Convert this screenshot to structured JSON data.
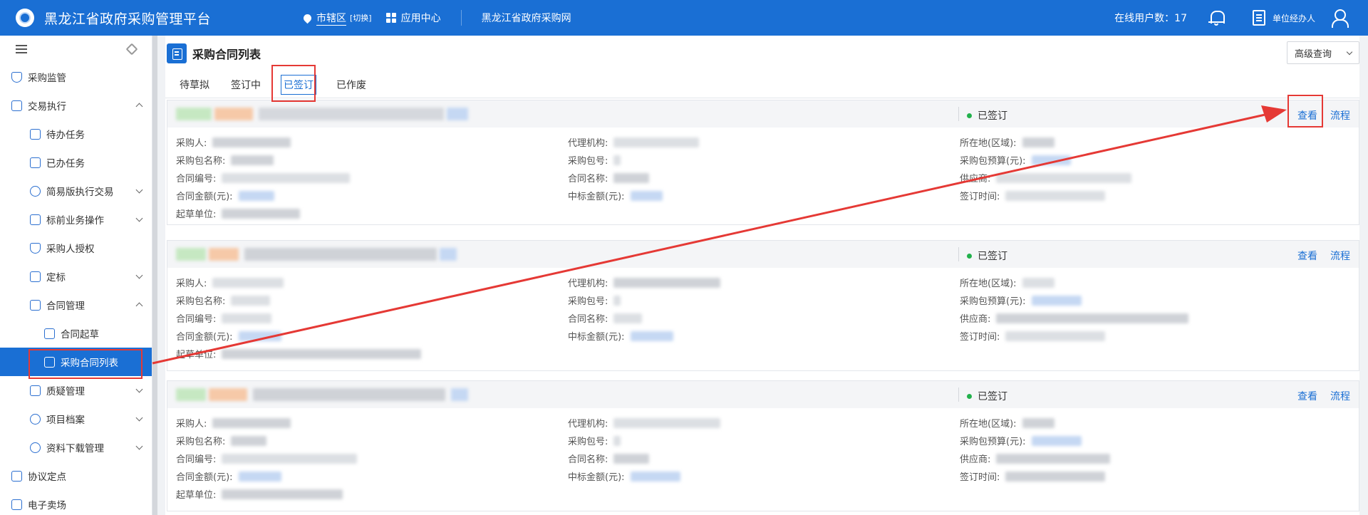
{
  "app": {
    "title": "黑龙江省政府采购管理平台",
    "region": "市辖区",
    "region_switch": "[切换]",
    "app_center": "应用中心",
    "portal": "黑龙江省政府采购网",
    "online_label": "在线用户数：17",
    "role": "单位经办人"
  },
  "sidebar": {
    "items": [
      {
        "label": "采购监管",
        "icon": "shield-icon",
        "level": 0
      },
      {
        "label": "交易执行",
        "icon": "receipt-icon",
        "level": 0,
        "expanded": true
      },
      {
        "label": "待办任务",
        "icon": "task-icon",
        "level": 1
      },
      {
        "label": "已办任务",
        "icon": "task-done-icon",
        "level": 1
      },
      {
        "label": "简易版执行交易",
        "icon": "simple-trade-icon",
        "level": 1,
        "collapsed": true
      },
      {
        "label": "标前业务操作",
        "icon": "cart-icon",
        "level": 1,
        "collapsed": true
      },
      {
        "label": "采购人授权",
        "icon": "shield-check-icon",
        "level": 1
      },
      {
        "label": "定标",
        "icon": "award-icon",
        "level": 1,
        "collapsed": true
      },
      {
        "label": "合同管理",
        "icon": "contract-icon",
        "level": 1,
        "expanded": true
      },
      {
        "label": "合同起草",
        "icon": "draft-icon",
        "level": 2
      },
      {
        "label": "采购合同列表",
        "icon": "list-icon",
        "level": 2,
        "active": true
      },
      {
        "label": "质疑管理",
        "icon": "cart-icon",
        "level": 1,
        "collapsed": true
      },
      {
        "label": "项目档案",
        "icon": "user-circle-icon",
        "level": 1,
        "collapsed": true
      },
      {
        "label": "资料下载管理",
        "icon": "link-icon",
        "level": 1,
        "collapsed": true
      },
      {
        "label": "协议定点",
        "icon": "agreement-icon",
        "level": 0
      },
      {
        "label": "电子卖场",
        "icon": "store-icon",
        "level": 0
      }
    ]
  },
  "page": {
    "title": "采购合同列表",
    "advanced_query": "高级查询"
  },
  "tabs": [
    {
      "label": "待草拟"
    },
    {
      "label": "签订中"
    },
    {
      "label": "已签订",
      "active": true
    },
    {
      "label": "已作废"
    }
  ],
  "labels": {
    "buyer": "采购人:",
    "package_name": "采购包名称:",
    "contract_no": "合同编号:",
    "contract_amount": "合同金额(元):",
    "drafting_unit": "起草单位:",
    "agency": "代理机构:",
    "package_no": "采购包号:",
    "contract_name": "合同名称:",
    "bid_amount": "中标金额(元):",
    "location": "所在地(区域):",
    "package_budget": "采购包预算(元):",
    "supplier": "供应商:",
    "sign_time": "签订时间:"
  },
  "cards": [
    {
      "status": "已签订",
      "view": "查看",
      "process": "流程"
    },
    {
      "status": "已签订",
      "view": "查看",
      "process": "流程"
    },
    {
      "status": "已签订",
      "view": "查看",
      "process": "流程"
    }
  ],
  "colors": {
    "primary": "#1a6fd4",
    "annotation": "#e53935",
    "status_ok": "#22b14c"
  }
}
